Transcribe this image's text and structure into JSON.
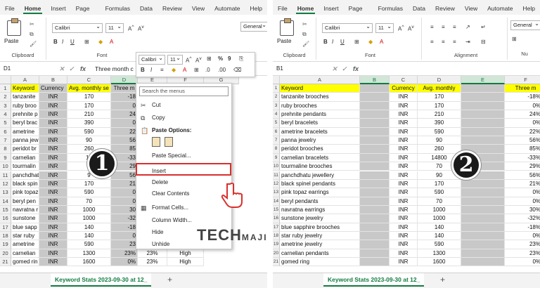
{
  "ribbon_tabs": [
    "File",
    "Home",
    "Insert",
    "Page Layout",
    "Formulas",
    "Data",
    "Review",
    "View",
    "Automate",
    "Help"
  ],
  "active_tab": "Home",
  "left": {
    "font_name": "Calibri",
    "font_size": "11",
    "number_format": "General",
    "groups": {
      "clipboard": "Clipboard",
      "font": "Font"
    },
    "paste_label": "Paste",
    "name_box": "D1",
    "formula": "Three month c",
    "columns": [
      "A",
      "B",
      "C",
      "D",
      "E",
      "F",
      "G"
    ],
    "selected_column": "D",
    "header_row": [
      "Keyword",
      "Currency",
      "Avg. monthly se",
      "Three m",
      "",
      "",
      ""
    ],
    "rows": [
      [
        "tanzanite",
        "INR",
        "170",
        "-18",
        ""
      ],
      [
        "ruby broo",
        "INR",
        "170",
        "0",
        ""
      ],
      [
        "prehnite p",
        "INR",
        "210",
        "24",
        ""
      ],
      [
        "beryl brac",
        "INR",
        "390",
        "0",
        ""
      ],
      [
        "ametrine",
        "INR",
        "590",
        "22",
        ""
      ],
      [
        "panna jew",
        "INR",
        "90",
        "56",
        ""
      ],
      [
        "peridot br",
        "INR",
        "260",
        "85",
        ""
      ],
      [
        "carnelian",
        "INR",
        "14",
        "-33",
        ""
      ],
      [
        "tourmalin",
        "INR",
        "7",
        "29",
        ""
      ],
      [
        "panchdhat",
        "INR",
        "9",
        "56",
        ""
      ],
      [
        "black spin",
        "INR",
        "170",
        "21",
        ""
      ],
      [
        "pink topaz",
        "INR",
        "590",
        "0",
        ""
      ],
      [
        "beryl pen",
        "INR",
        "70",
        "0",
        ""
      ],
      [
        "navratna r",
        "INR",
        "1000",
        "30",
        ""
      ],
      [
        "sunstone",
        "INR",
        "1000",
        "-32",
        ""
      ],
      [
        "blue sapp",
        "INR",
        "140",
        "-18",
        ""
      ],
      [
        "star ruby",
        "INR",
        "140",
        "0",
        ""
      ],
      [
        "ametrine",
        "INR",
        "590",
        "23",
        ""
      ],
      [
        "carnelian",
        "INR",
        "1300",
        "23%",
        "High"
      ],
      [
        "gomed rin",
        "INR",
        "1600",
        "0%",
        "High"
      ]
    ],
    "extra_col_E": [
      "",
      "",
      "",
      "",
      "",
      "",
      "",
      "",
      "",
      "",
      "",
      "",
      "",
      "",
      "",
      "",
      "",
      "",
      "23%",
      "23%"
    ],
    "sheet_tab": "Keyword Stats 2023-09-30 at 12_",
    "badge": "1"
  },
  "mini_toolbar": {
    "font": "Calibri",
    "size": "11",
    "buttons": [
      "B",
      "I",
      "A",
      "A",
      "%",
      "9"
    ]
  },
  "context_menu": {
    "search_placeholder": "Search the menus",
    "items": [
      {
        "label": "Cut",
        "icon": "scissors-icon",
        "glyph": "✂"
      },
      {
        "label": "Copy",
        "icon": "copy-icon",
        "glyph": "⧉"
      },
      {
        "label": "Paste Options:",
        "icon": "clipboard-icon",
        "glyph": "📋"
      },
      {
        "label": "Paste Special...",
        "icon": "",
        "glyph": ""
      },
      {
        "label": "Insert",
        "icon": "",
        "glyph": ""
      },
      {
        "label": "Delete",
        "icon": "",
        "glyph": ""
      },
      {
        "label": "Clear Contents",
        "icon": "",
        "glyph": ""
      },
      {
        "label": "Format Cells...",
        "icon": "format-cells-icon",
        "glyph": "▦"
      },
      {
        "label": "Column Width...",
        "icon": "",
        "glyph": ""
      },
      {
        "label": "Hide",
        "icon": "",
        "glyph": ""
      },
      {
        "label": "Unhide",
        "icon": "",
        "glyph": ""
      }
    ]
  },
  "watermark": {
    "main": "TECH",
    "sub": "MAJIN"
  },
  "right": {
    "font_name": "Calibri",
    "font_size": "11",
    "number_format": "General",
    "groups": {
      "clipboard": "Clipboard",
      "font": "Font",
      "alignment": "Alignment",
      "number": "Nu"
    },
    "paste_label": "Paste",
    "name_box": "B1",
    "columns": [
      "A",
      "B",
      "C",
      "D",
      "E",
      "F"
    ],
    "header_row": [
      "Keyword",
      "",
      "Currency",
      "Avg. monthly",
      "",
      "Three m"
    ],
    "rows": [
      [
        "tanzanite brooches",
        "INR",
        "170",
        "-18%"
      ],
      [
        "ruby brooches",
        "INR",
        "170",
        "0%"
      ],
      [
        "prehnite pendants",
        "INR",
        "210",
        "24%"
      ],
      [
        "beryl bracelets",
        "INR",
        "390",
        "0%"
      ],
      [
        "ametrine bracelets",
        "INR",
        "590",
        "22%"
      ],
      [
        "panna jewelry",
        "INR",
        "90",
        "56%"
      ],
      [
        "peridot brooches",
        "INR",
        "260",
        "85%"
      ],
      [
        "carnelian bracelets",
        "INR",
        "14800",
        "-33%"
      ],
      [
        "tourmaline brooches",
        "INR",
        "70",
        "29%"
      ],
      [
        "panchdhatu jewellery",
        "INR",
        "90",
        "56%"
      ],
      [
        "black spinel pendants",
        "INR",
        "170",
        "21%"
      ],
      [
        "pink topaz earrings",
        "INR",
        "590",
        "0%"
      ],
      [
        "beryl pendants",
        "INR",
        "70",
        "0%"
      ],
      [
        "navratna earrings",
        "INR",
        "1000",
        "30%"
      ],
      [
        "sunstone jewelry",
        "INR",
        "1000",
        "-32%"
      ],
      [
        "blue sapphire brooches",
        "INR",
        "140",
        "-18%"
      ],
      [
        "star ruby jewelry",
        "INR",
        "140",
        "0%"
      ],
      [
        "ametrine jewelry",
        "INR",
        "590",
        "23%"
      ],
      [
        "carnelian pendants",
        "INR",
        "1300",
        "23%"
      ],
      [
        "gomed ring",
        "INR",
        "1600",
        "0%"
      ]
    ],
    "sheet_tab": "Keyword Stats 2023-09-30 at 12_",
    "badge": "2"
  }
}
